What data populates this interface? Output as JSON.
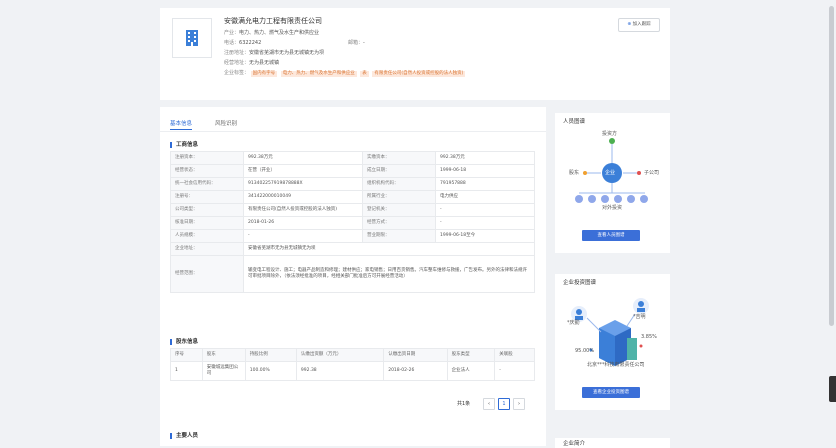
{
  "header": {
    "company_name": "安徽满允电力工程有限责任公司",
    "industry_label": "产业：",
    "industry_value": "电力、热力、燃气及水生产和供应业",
    "phone_label": "电话：",
    "phone_value": "6322242",
    "email_label": "邮箱：",
    "email_value": "-",
    "reg_address_label": "注册地址：",
    "reg_address_value": "安徽省芜湖市无为县无城镇无为坝",
    "biz_address_label": "经营地址：",
    "biz_address_value": "无为县无城镇",
    "tags_label": "企业标签：",
    "tags": [
      "国内有字号",
      "电力、热力、燃气及水生产和供应业",
      "表",
      "有限责任公司(自然人投资或控股的法人独资)"
    ],
    "follow_button": "加入跟踪"
  },
  "tabs": [
    "基本信息",
    "风险识别"
  ],
  "business_info": {
    "title": "工商信息",
    "rows": [
      [
        "注册资本：",
        "992.38万元",
        "实缴资本：",
        "992.38万元"
      ],
      [
        "经营状态：",
        "在营（开业）",
        "成立日期：",
        "1999-06-18"
      ],
      [
        "统一社会信用代码：",
        "913402257919878888X",
        "组织机构代码：",
        "791957888"
      ],
      [
        "注册号：",
        "341422000010049",
        "所属行业：",
        "电力供应"
      ],
      [
        "公司类型：",
        "有限责任公司(自然人投资或控股的法人独资)",
        "登记机关：",
        "-"
      ],
      [
        "核准日期：",
        "2018-01-26",
        "经营方式：",
        "-"
      ],
      [
        "人员规模：",
        "-",
        "营业期限：",
        "1999-06-18至今"
      ]
    ],
    "address_label": "企业地址：",
    "address_value": "安徽省芜湖市无为县无城镇无为坝",
    "scope_label": "经营范围：",
    "scope_value": "输变电工程设计、施工；电器产品制造和修理；建材供应；家电销售；日用百货销售。汽车整车维修与救援，广告发布。另外的法律和法规许可审批项目除外，（依法须经批准的项目，经相关部门批准后方可开展经营活动）"
  },
  "shareholders": {
    "title": "股东信息",
    "headers": [
      "序号",
      "股东",
      "持股比例",
      "认缴出资额（万元）",
      "认缴出资日期",
      "股东类型",
      "关联股"
    ],
    "rows": [
      [
        "1",
        "安徽城远集团公司",
        "100.00%",
        "992.38",
        "2018-02-26",
        "企业法人",
        "-"
      ]
    ],
    "total_text": "共1条",
    "page": "1",
    "prev": "‹",
    "next": "›"
  },
  "main_people_title": "主要人员",
  "people_panel": {
    "title": "人员图谱",
    "top_node": "投资方",
    "center_node": "企业",
    "left_node": "股东",
    "right_node": "子公司",
    "bottom_label": "对外投资",
    "button": "查看人员图谱"
  },
  "invest_panel": {
    "title": "企业投资图谱",
    "left_person": "*庆勤",
    "right_person": "*吉明",
    "pct_left": "95.00%",
    "pct_right": "3.85%",
    "company_caption": "北京***科技有限责任公司",
    "button": "查看企业投资图谱"
  },
  "more_panel_title": "企业简介"
}
